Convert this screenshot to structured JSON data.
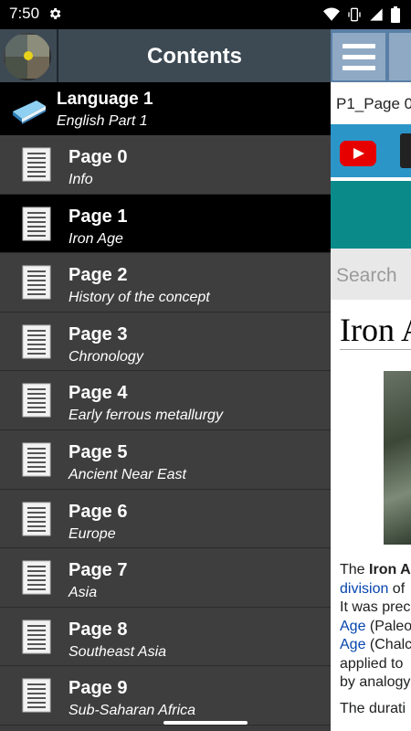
{
  "status": {
    "time": "7:50"
  },
  "background": {
    "url_text": "P1_Page 0",
    "search_placeholder": "Search",
    "article_title": "Iron A",
    "lines": [
      {
        "pre": "The ",
        "bold": "Iron A",
        "link": "",
        "post": ""
      },
      {
        "pre": "",
        "bold": "",
        "link": "division",
        "post": " of"
      },
      {
        "pre": "It was prec",
        "bold": "",
        "link": "",
        "post": ""
      },
      {
        "pre": "",
        "bold": "",
        "link": "Age",
        "post": " (Paleo"
      },
      {
        "pre": "",
        "bold": "",
        "link": "Age",
        "post": " (Chalc"
      },
      {
        "pre": "applied to",
        "bold": "",
        "link": "",
        "post": ""
      },
      {
        "pre": "by analogy",
        "bold": "",
        "link": "",
        "post": ""
      },
      {
        "pre": "The durati",
        "bold": "",
        "link": "",
        "post": ""
      }
    ]
  },
  "drawer": {
    "title": "Contents",
    "language": {
      "title": "Language 1",
      "subtitle": "English Part 1"
    },
    "pages": [
      {
        "title": "Page 0",
        "subtitle": "Info",
        "selected": false
      },
      {
        "title": "Page 1",
        "subtitle": "Iron Age",
        "selected": true
      },
      {
        "title": "Page 2",
        "subtitle": "History of the concept",
        "selected": false
      },
      {
        "title": "Page 3",
        "subtitle": "Chronology",
        "selected": false
      },
      {
        "title": "Page 4",
        "subtitle": "Early ferrous metallurgy",
        "selected": false
      },
      {
        "title": "Page 5",
        "subtitle": "Ancient Near East",
        "selected": false
      },
      {
        "title": "Page 6",
        "subtitle": "Europe",
        "selected": false
      },
      {
        "title": "Page 7",
        "subtitle": "Asia",
        "selected": false
      },
      {
        "title": "Page 8",
        "subtitle": "Southeast Asia",
        "selected": false
      },
      {
        "title": "Page 9",
        "subtitle": "Sub-Saharan Africa",
        "selected": false
      }
    ]
  },
  "icons": {
    "status": [
      "gear-icon",
      "wifi-icon",
      "vibrate-icon",
      "signal-icon",
      "battery-icon"
    ],
    "menu": "hamburger-icon",
    "youtube": "youtube-icon",
    "language": "book-icon",
    "page": "document-icon"
  },
  "colors": {
    "drawer_bg": "#3e3e3e",
    "selected_bg": "#000000",
    "header_bg": "#3d4a54",
    "toolbar_bg": "#5a7fa6",
    "teal": "#0b8a8a",
    "link": "#0645ad"
  }
}
